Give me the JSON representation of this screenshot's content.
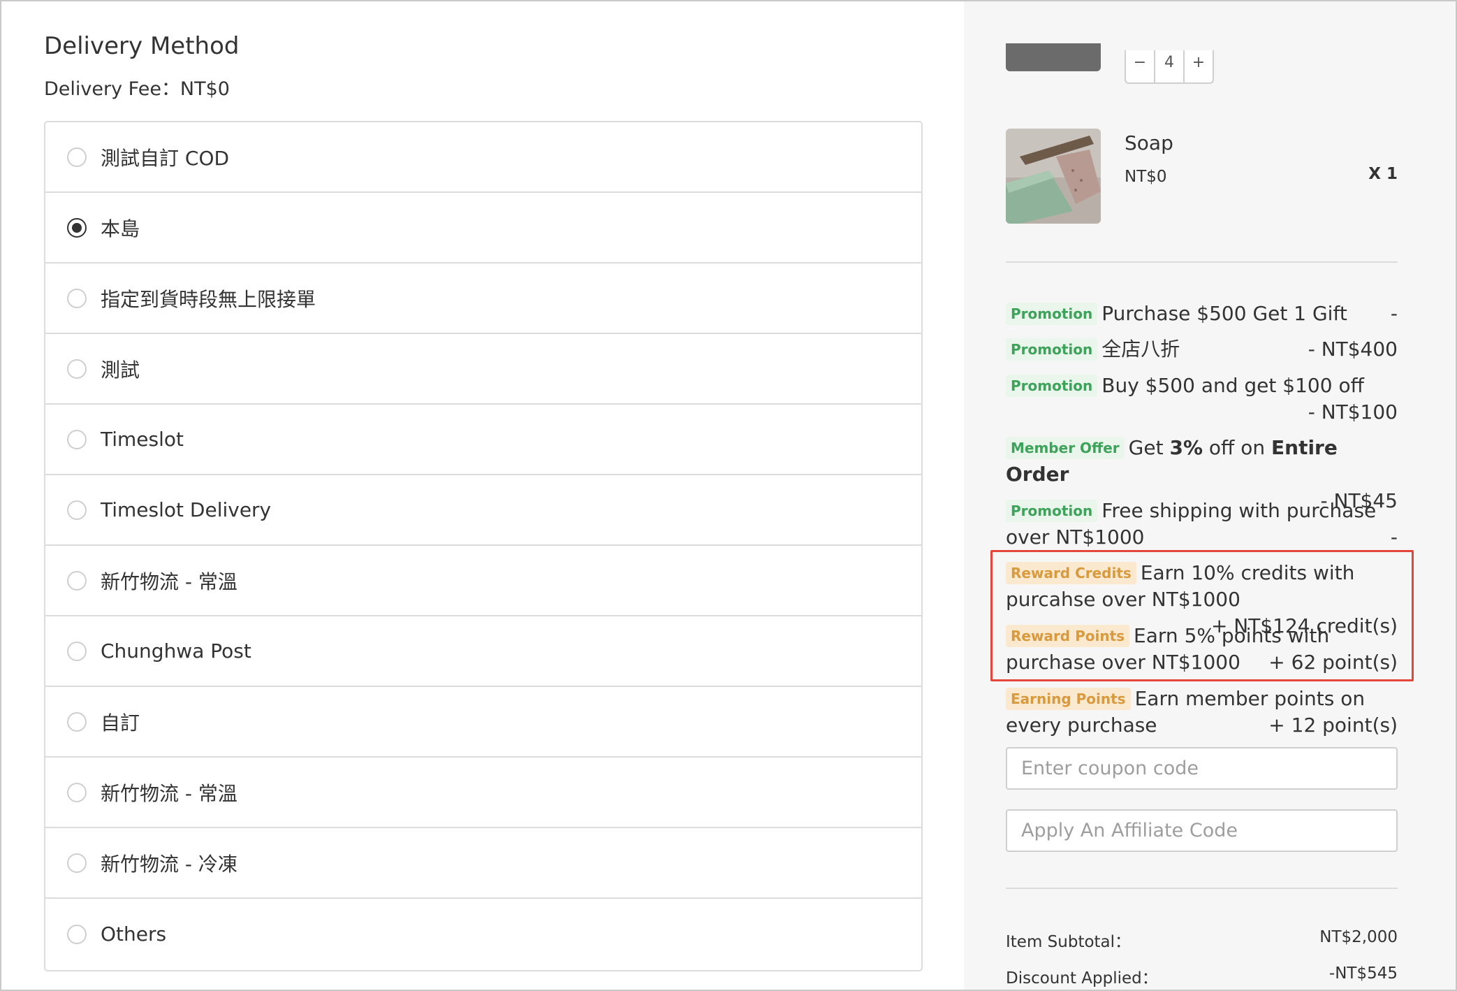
{
  "delivery": {
    "title": "Delivery Method",
    "fee_label": "Delivery Fee：NT$0",
    "options": [
      {
        "label": "測試自訂 COD",
        "selected": false
      },
      {
        "label": "本島",
        "selected": true
      },
      {
        "label": "指定到貨時段無上限接單",
        "selected": false
      },
      {
        "label": "測試",
        "selected": false
      },
      {
        "label": "Timeslot",
        "selected": false
      },
      {
        "label": "Timeslot Delivery",
        "selected": false
      },
      {
        "label": "新竹物流 - 常溫",
        "selected": false
      },
      {
        "label": "Chunghwa Post",
        "selected": false
      },
      {
        "label": "自訂",
        "selected": false
      },
      {
        "label": "新竹物流 - 常溫",
        "selected": false
      },
      {
        "label": "新竹物流 - 冷凍",
        "selected": false
      },
      {
        "label": "Others",
        "selected": false
      }
    ]
  },
  "cart": {
    "prev_item": {
      "quantity": "4",
      "minus": "−",
      "plus": "+"
    },
    "item": {
      "name": "Soap",
      "price": "NT$0",
      "quantity": "X 1"
    }
  },
  "offers": {
    "promo1": {
      "tag": "Promotion",
      "text": "Purchase $500 Get 1 Gift",
      "amount": "-"
    },
    "promo2": {
      "tag": "Promotion",
      "text": "全店八折",
      "amount": "- NT$400"
    },
    "promo3": {
      "tag": "Promotion",
      "text": "Buy $500 and get $100 off",
      "amount": "- NT$100"
    },
    "member": {
      "tag": "Member Offer",
      "text_pre": "Get ",
      "bold1": "3%",
      "text_mid": " off on ",
      "bold2": "Entire Order",
      "amount": "- NT$45"
    },
    "promo4": {
      "tag": "Promotion",
      "text": "Free shipping with purchase over NT$1000",
      "amount": "-"
    },
    "reward_credits": {
      "tag": "Reward Credits",
      "text": "Earn 10% credits with purcahse over NT$1000",
      "amount": "+ NT$124 credit(s)"
    },
    "reward_points": {
      "tag": "Reward Points",
      "text": "Earn 5% points with purchase over NT$1000",
      "amount": "+ 62 point(s)"
    },
    "earning_points": {
      "tag": "Earning Points",
      "text": "Earn member points on every purchase",
      "amount": "+ 12 point(s)"
    }
  },
  "coupon": {
    "placeholder": "Enter coupon code"
  },
  "affiliate": {
    "placeholder": "Apply An Affiliate Code"
  },
  "summary": {
    "subtotal_label": "Item Subtotal：",
    "subtotal_value": "NT$2,000",
    "discount_label": "Discount Applied：",
    "discount_value": "-NT$545"
  },
  "colors": {
    "promotion_tag": "#3da35a",
    "reward_tag": "#d99a3e",
    "highlight_border": "#e5463c"
  }
}
